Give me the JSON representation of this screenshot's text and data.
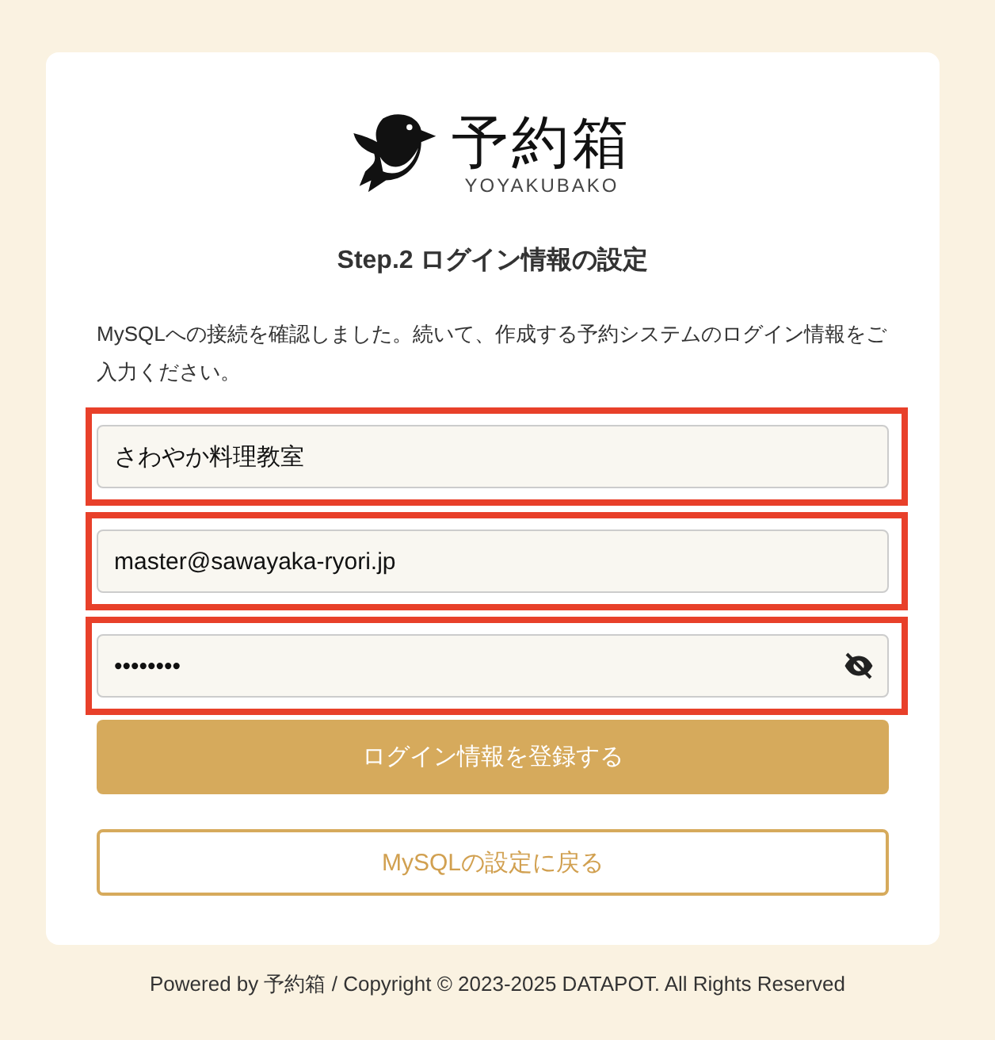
{
  "logo": {
    "title": "予約箱",
    "subtitle": "YOYAKUBAKO"
  },
  "heading": "Step.2 ログイン情報の設定",
  "description": "MySQLへの接続を確認しました。続いて、作成する予約システムのログイン情報をご入力ください。",
  "fields": [
    {
      "kind": "text",
      "value": "さわやか料理教室",
      "highlighted": true
    },
    {
      "kind": "text",
      "value": "master@sawayaka-ryori.jp",
      "highlighted": true
    },
    {
      "kind": "password",
      "value": "••••••••",
      "highlighted": true
    }
  ],
  "buttons": [
    {
      "kind": "primary",
      "label": "ログイン情報を登録する"
    },
    {
      "kind": "outline",
      "label": "MySQLの設定に戻る"
    }
  ],
  "footer": "Powered by 予約箱 / Copyright © 2023-2025 DATAPOT. All Rights Reserved"
}
